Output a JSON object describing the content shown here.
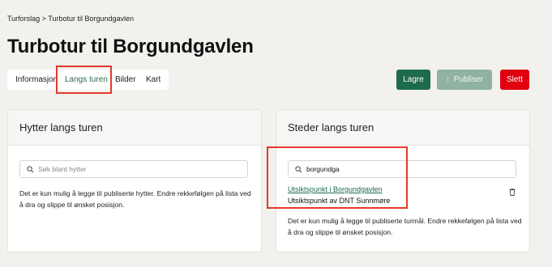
{
  "breadcrumb": "Turforslag > Turbotur til Borgundgavlen",
  "page_title": "Turbotur til Borgundgavlen",
  "tabs": [
    {
      "label": "Informasjon",
      "active": false
    },
    {
      "label": "Langs turen",
      "active": true
    },
    {
      "label": "Bilder",
      "active": false
    },
    {
      "label": "Kart",
      "active": false
    }
  ],
  "actions": {
    "save": "Lagre",
    "publish": "Publiser",
    "delete": "Slett"
  },
  "huts": {
    "title": "Hytter langs turen",
    "search_placeholder": "Søk blant hytter",
    "search_value": "",
    "help": "Det er kun mulig å legge til publiserte hytter. Endre rekkefølgen på lista ved å dra og slippe til ønsket posisjon."
  },
  "places": {
    "title": "Steder langs turen",
    "search_placeholder": "",
    "search_value": "borgundga",
    "result": {
      "name": "Utsiktspunkt i Borgundgavlen",
      "subtitle": "Utsiktspunkt av DNT Sunnmøre"
    },
    "help": "Det er kun mulig å legge til publiserte turmål. Endre rekkefølgen på lista ved å dra og slippe til ønsket posisjon."
  },
  "colors": {
    "primary": "#1e6b4b",
    "primary_disabled": "#8fb2a3",
    "danger": "#e00010",
    "highlight": "#e3382b",
    "background": "#f2f1ee"
  },
  "icons": {
    "search": "search-icon",
    "publish": "arrow-up-icon",
    "remove": "trash-icon"
  }
}
